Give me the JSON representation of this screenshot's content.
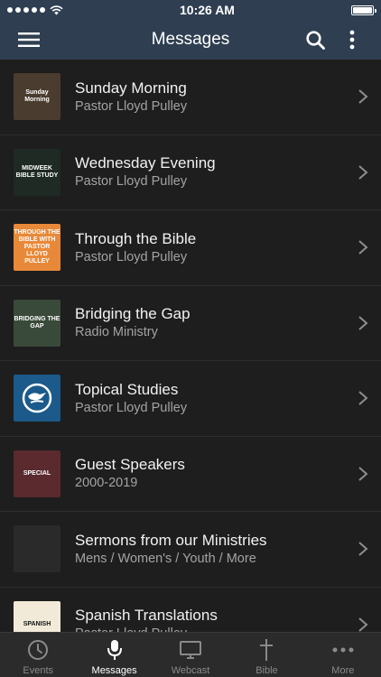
{
  "status_bar": {
    "time": "10:26 AM",
    "signal_bars": 5,
    "battery_level": 1.0
  },
  "navbar": {
    "title": "Messages",
    "menu_icon": "hamburger-menu-icon",
    "search_icon": "search-icon",
    "more_icon": "vertical-more-icon"
  },
  "list": {
    "items": [
      {
        "title": "Sunday Morning",
        "subtitle": "Pastor Lloyd Pulley",
        "thumb_text": "Sunday Morning",
        "thumb_color": "#4a3c2e"
      },
      {
        "title": "Wednesday Evening",
        "subtitle": "Pastor Lloyd Pulley",
        "thumb_text": "MIDWEEK BIBLE STUDY",
        "thumb_color": "#1f2a24"
      },
      {
        "title": "Through the Bible",
        "subtitle": "Pastor Lloyd Pulley",
        "thumb_text": "THROUGH THE BIBLE WITH PASTOR LLOYD PULLEY",
        "thumb_color": "#e8893a"
      },
      {
        "title": "Bridging the Gap",
        "subtitle": "Radio Ministry",
        "thumb_text": "BRIDGING THE GAP",
        "thumb_color": "#3a4a3a"
      },
      {
        "title": "Topical Studies",
        "subtitle": "Pastor Lloyd Pulley",
        "thumb_text": "",
        "thumb_color": "#1b5a8a"
      },
      {
        "title": "Guest Speakers",
        "subtitle": "2000-2019",
        "thumb_text": "SPECIAL",
        "thumb_color": "#5a2a2e"
      },
      {
        "title": "Sermons from our Ministries",
        "subtitle": "Mens / Women's / Youth / More",
        "thumb_text": "",
        "thumb_color": "#2a2a2a"
      },
      {
        "title": "Spanish Translations",
        "subtitle": "Pastor Lloyd Pulley",
        "thumb_text": "SPANISH",
        "thumb_color": "#f2ead8"
      }
    ]
  },
  "tabbar": {
    "tabs": [
      {
        "label": "Events",
        "icon": "clock-icon",
        "active": false
      },
      {
        "label": "Messages",
        "icon": "microphone-icon",
        "active": true
      },
      {
        "label": "Webcast",
        "icon": "monitor-icon",
        "active": false
      },
      {
        "label": "Bible",
        "icon": "cross-icon",
        "active": false
      },
      {
        "label": "More",
        "icon": "ellipsis-icon",
        "active": false
      }
    ]
  },
  "colors": {
    "navbar_bg": "#2f3f51",
    "list_bg": "#1e1e1e",
    "tabbar_bg": "#2b2b2b",
    "active_tab": "#ffffff",
    "inactive_tab": "#8a8a8a"
  }
}
